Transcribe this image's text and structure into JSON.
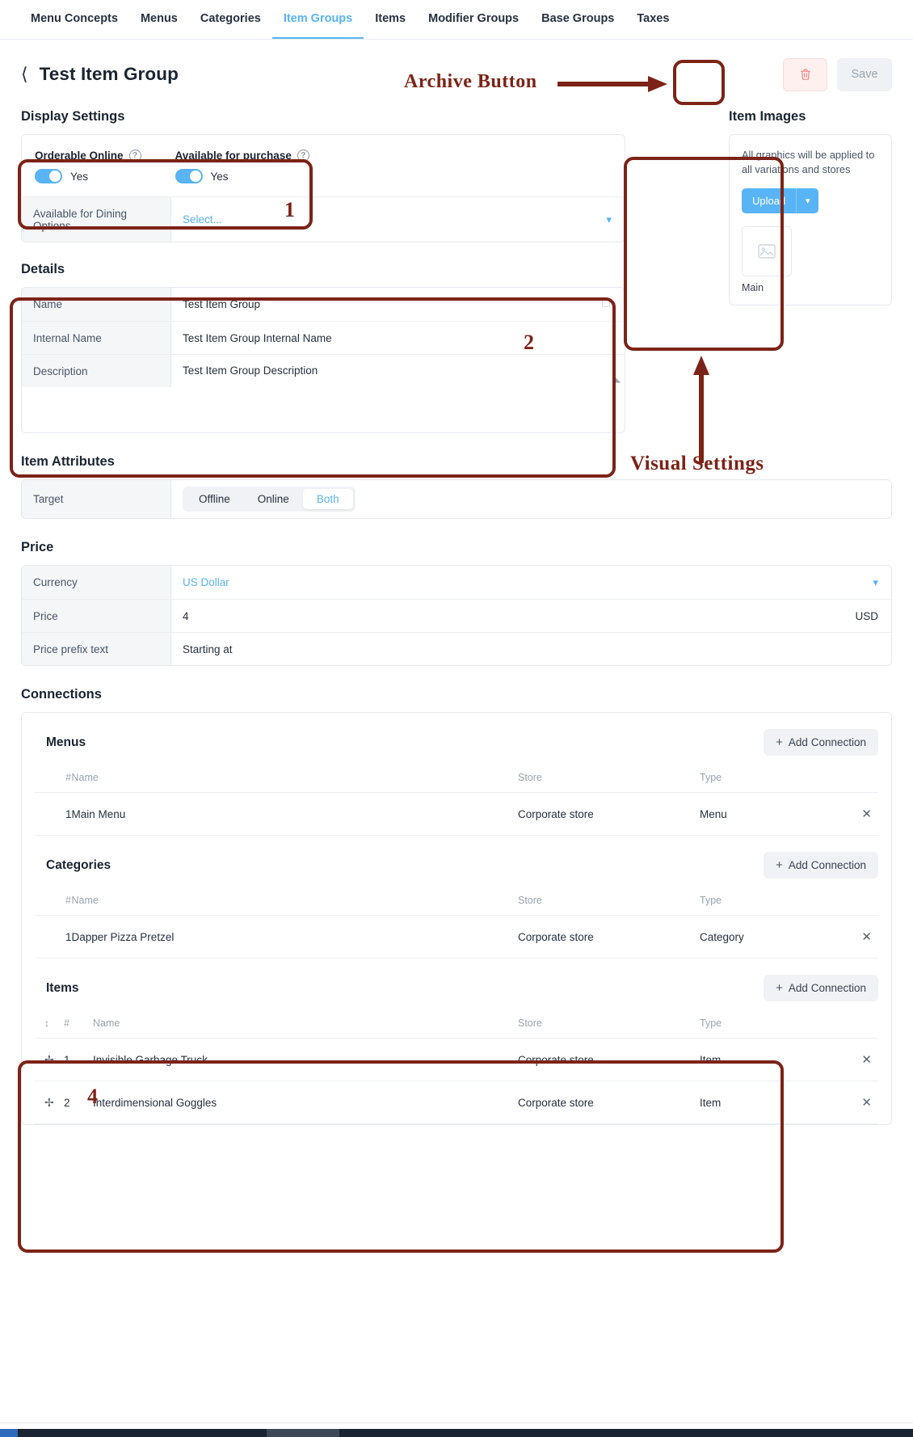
{
  "topnav": {
    "items": [
      {
        "label": "Menu Concepts",
        "active": false
      },
      {
        "label": "Menus",
        "active": false
      },
      {
        "label": "Categories",
        "active": false
      },
      {
        "label": "Item Groups",
        "active": true
      },
      {
        "label": "Items",
        "active": false
      },
      {
        "label": "Modifier Groups",
        "active": false
      },
      {
        "label": "Base Groups",
        "active": false
      },
      {
        "label": "Taxes",
        "active": false
      }
    ]
  },
  "header": {
    "back_icon": "chevron-left-icon",
    "title": "Test Item Group",
    "archive_icon": "trash-icon",
    "save_label": "Save"
  },
  "annotations": {
    "archive_label": "Archive Button",
    "visual_settings_label": "Visual Settings",
    "n1": "1",
    "n2": "2",
    "n4": "4",
    "color": "#7c2317"
  },
  "display_settings": {
    "title": "Display Settings",
    "orderable_online": {
      "label": "Orderable Online",
      "help_icon": "question-circle-icon",
      "value": "Yes",
      "on": true
    },
    "available_for_purchase": {
      "label": "Available for purchase",
      "help_icon": "question-circle-icon",
      "value": "Yes",
      "on": true
    },
    "dining_options": {
      "label": "Available for Dining Options",
      "placeholder": "Select...",
      "caret_icon": "chevron-down-icon"
    }
  },
  "item_images": {
    "title": "Item Images",
    "note": "All graphics will be applied to all variations and stores",
    "upload_label": "Upload",
    "upload_caret_icon": "chevron-down-icon",
    "thumb_icon": "image-placeholder-icon",
    "thumb_caption": "Main"
  },
  "details": {
    "title": "Details",
    "rows": [
      {
        "label": "Name",
        "value": "Test Item Group",
        "icon": "copy-icon"
      },
      {
        "label": "Internal Name",
        "value": "Test Item Group Internal Name",
        "icon": ""
      },
      {
        "label": "Description",
        "value": "Test Item Group Description",
        "icon": "resize-grip-icon"
      }
    ]
  },
  "item_attributes": {
    "title": "Item Attributes",
    "target_label": "Target",
    "options": [
      "Offline",
      "Online",
      "Both"
    ],
    "selected": "Both"
  },
  "price": {
    "title": "Price",
    "rows": [
      {
        "label": "Currency",
        "value": "US Dollar",
        "suffix": "",
        "link": true,
        "caret": true
      },
      {
        "label": "Price",
        "value": "4",
        "suffix": "USD",
        "link": false,
        "caret": false
      },
      {
        "label": "Price prefix text",
        "value": "Starting at",
        "suffix": "",
        "link": false,
        "caret": false
      }
    ]
  },
  "connections": {
    "title": "Connections",
    "add_label": "Add Connection",
    "add_icon": "plus-icon",
    "remove_icon": "close-icon",
    "drag_icon": "drag-handle-icon",
    "blocks": [
      {
        "title": "Menus",
        "draggable": false,
        "columns": [
          "#",
          "Name",
          "Store",
          "Type"
        ],
        "rows": [
          {
            "num": "1",
            "name": "Main Menu",
            "store": "Corporate store",
            "type": "Menu"
          }
        ]
      },
      {
        "title": "Categories",
        "draggable": false,
        "columns": [
          "#",
          "Name",
          "Store",
          "Type"
        ],
        "rows": [
          {
            "num": "1",
            "name": "Dapper Pizza Pretzel",
            "store": "Corporate store",
            "type": "Category"
          }
        ]
      },
      {
        "title": "Items",
        "draggable": true,
        "columns": [
          "#",
          "Name",
          "Store",
          "Type"
        ],
        "rows": [
          {
            "num": "1",
            "name": "Invisible Garbage Truck",
            "store": "Corporate store",
            "type": "Item"
          },
          {
            "num": "2",
            "name": "Interdimensional Goggles",
            "store": "Corporate store",
            "type": "Item"
          }
        ]
      }
    ]
  }
}
